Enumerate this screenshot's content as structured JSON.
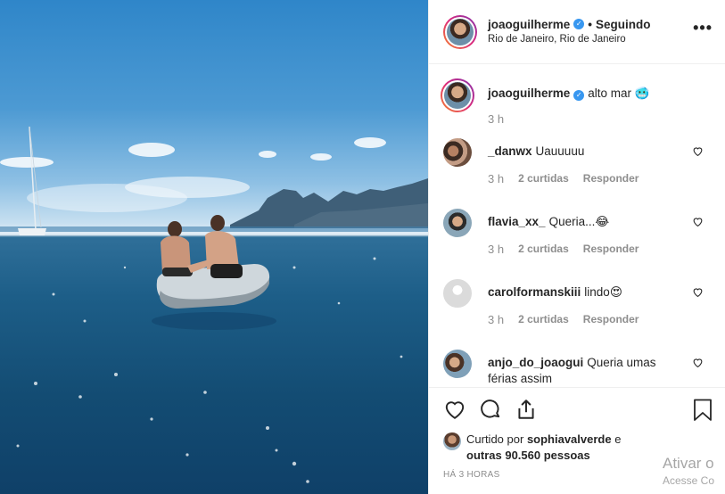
{
  "post": {
    "username": "joaoguilherme",
    "follow_separator": "•",
    "follow_status": "Seguindo",
    "location": "Rio de Janeiro, Rio de Janeiro",
    "more_label": "•••"
  },
  "caption": {
    "username": "joaoguilherme",
    "text": "alto mar 🥶",
    "time": "3 h"
  },
  "comments": [
    {
      "username": "_danwx",
      "text": "Uauuuuu",
      "time": "3 h",
      "likes": "2 curtidas",
      "reply": "Responder"
    },
    {
      "username": "flavia_xx_",
      "text": "Queria...😂",
      "time": "3 h",
      "likes": "2 curtidas",
      "reply": "Responder"
    },
    {
      "username": "carolformanskiii",
      "text": "lindo😍",
      "time": "3 h",
      "likes": "2 curtidas",
      "reply": "Responder"
    },
    {
      "username": "anjo_do_joaogui",
      "text": "Queria umas férias assim",
      "time": "",
      "likes": "",
      "reply": ""
    }
  ],
  "likes": {
    "prefix": "Curtido por",
    "user": "sophiavalverde",
    "and": "e",
    "others": "outras 90.560 pessoas"
  },
  "timestamp": "HÁ 3 HORAS",
  "watermark": {
    "line1": "Ativar o",
    "line2": "Acesse Co"
  },
  "colors": {
    "verified": "#3897f0",
    "muted": "#8e8e8e",
    "text": "#262626",
    "border": "#efefef"
  },
  "icons": [
    "heart-icon",
    "comment-icon",
    "share-icon",
    "bookmark-icon",
    "more-icon",
    "verified-icon"
  ]
}
